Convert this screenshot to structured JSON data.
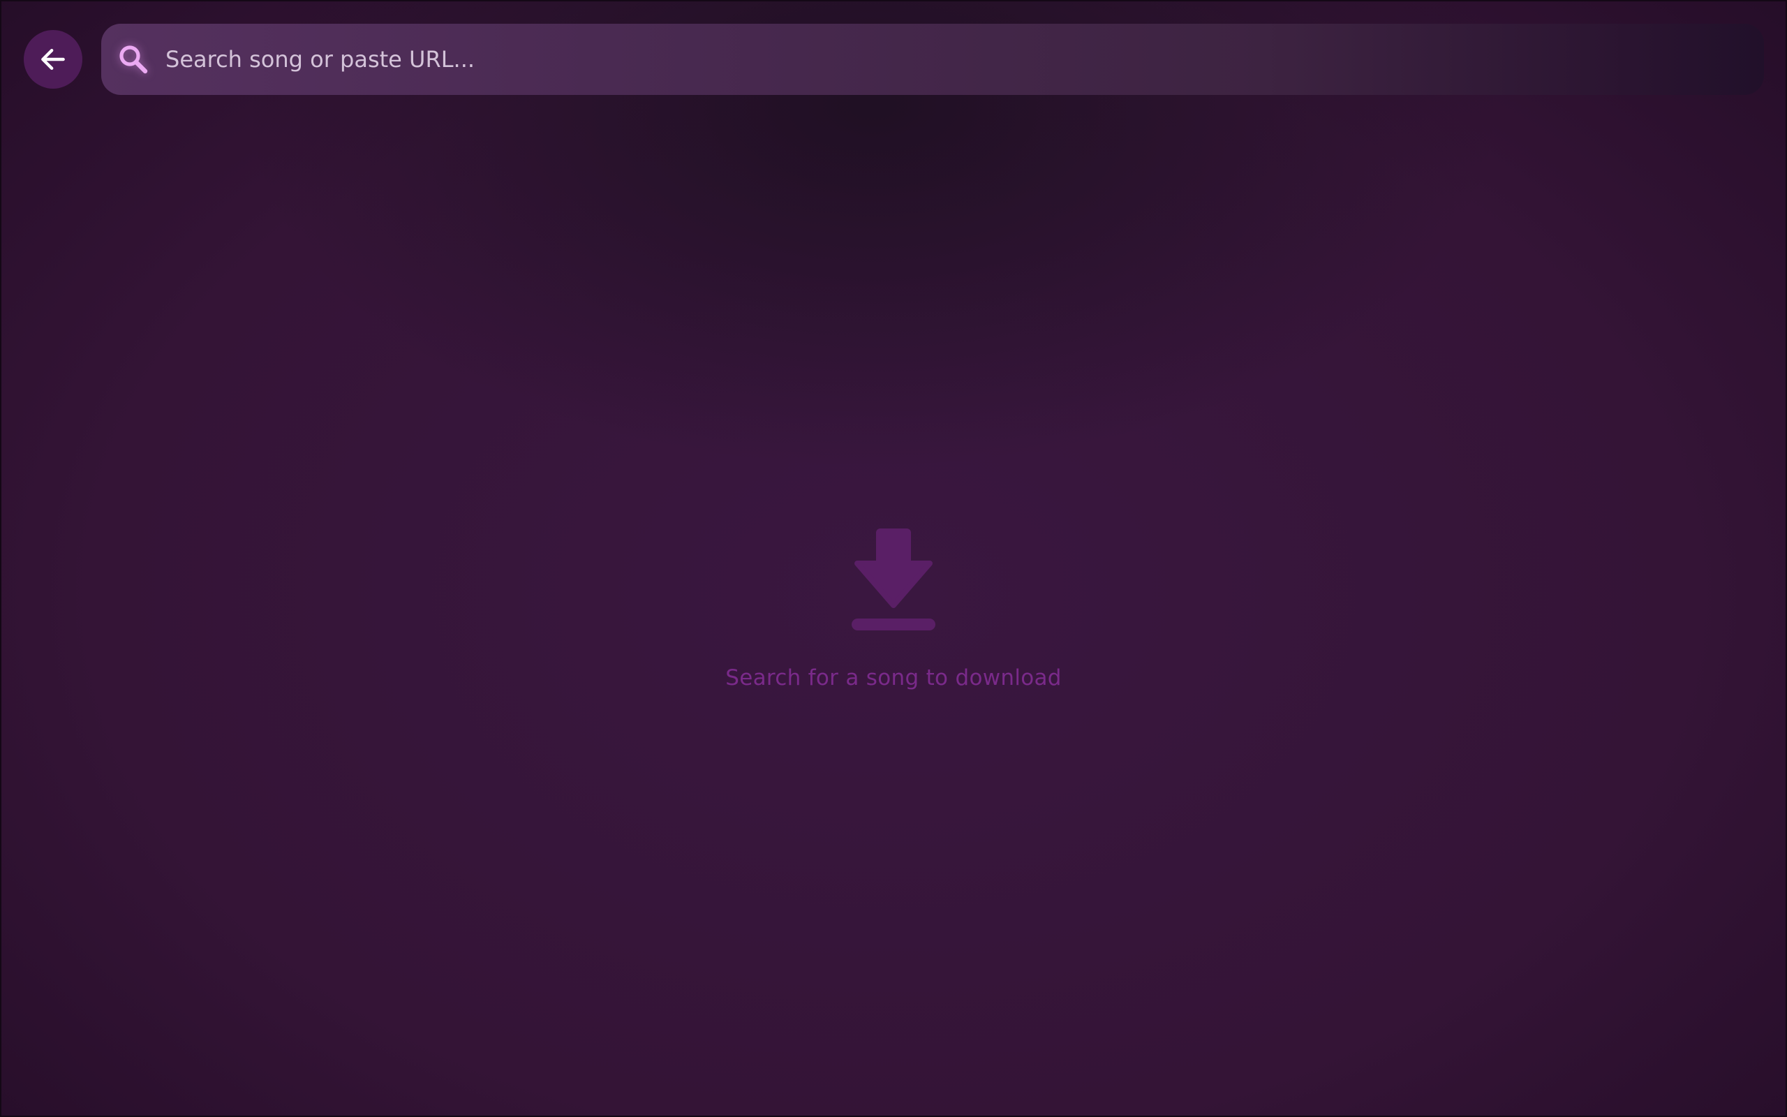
{
  "header": {
    "back_icon": "arrow-left-icon",
    "search": {
      "icon": "search-icon",
      "placeholder": "Search song or paste URL...",
      "value": ""
    }
  },
  "main": {
    "empty_state": {
      "icon": "download-icon",
      "message": "Search for a song to download"
    }
  },
  "colors": {
    "background": "#35153a",
    "accent": "#4e1c58",
    "empty_icon": "#5a1f66",
    "empty_text": "#7a2a8a",
    "search_icon": "#e8a0f0"
  }
}
